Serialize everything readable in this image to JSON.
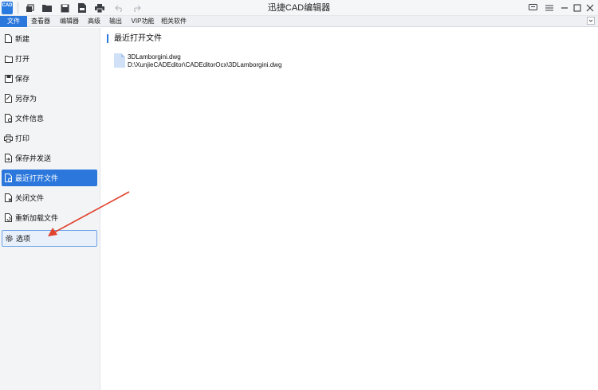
{
  "app": {
    "title": "迅捷CAD编辑器",
    "logo_text": "CAD"
  },
  "quick_access": [
    {
      "name": "new-window-icon"
    },
    {
      "name": "open-folder-icon"
    },
    {
      "name": "save-icon"
    },
    {
      "name": "export-pdf-icon"
    },
    {
      "name": "print-icon"
    },
    {
      "name": "undo-icon"
    },
    {
      "name": "redo-icon"
    }
  ],
  "window_controls": [
    {
      "name": "message-icon"
    },
    {
      "name": "menu-icon"
    },
    {
      "name": "minimize-icon"
    },
    {
      "name": "maximize-icon"
    },
    {
      "name": "close-icon"
    }
  ],
  "menu": {
    "items": [
      {
        "label": "文件",
        "active": true
      },
      {
        "label": "查看器",
        "active": false
      },
      {
        "label": "编辑器",
        "active": false
      },
      {
        "label": "高级",
        "active": false
      },
      {
        "label": "输出",
        "active": false
      },
      {
        "label": "VIP功能",
        "active": false
      },
      {
        "label": "相关软件",
        "active": false
      }
    ]
  },
  "sidebar": {
    "items": [
      {
        "label": "新建",
        "icon": "new-file-icon",
        "state": "normal"
      },
      {
        "label": "打开",
        "icon": "open-icon",
        "state": "normal"
      },
      {
        "label": "保存",
        "icon": "save-icon",
        "state": "normal"
      },
      {
        "label": "另存为",
        "icon": "save-as-icon",
        "state": "normal"
      },
      {
        "label": "文件信息",
        "icon": "file-info-icon",
        "state": "normal"
      },
      {
        "label": "打印",
        "icon": "print-icon",
        "state": "normal"
      },
      {
        "label": "保存并发送",
        "icon": "save-send-icon",
        "state": "normal"
      },
      {
        "label": "最近打开文件",
        "icon": "recent-files-icon",
        "state": "active"
      },
      {
        "label": "关闭文件",
        "icon": "close-file-icon",
        "state": "normal"
      },
      {
        "label": "重新加载文件",
        "icon": "reload-file-icon",
        "state": "normal"
      },
      {
        "label": "选项",
        "icon": "gear-icon",
        "state": "hover"
      }
    ]
  },
  "main": {
    "section_title": "最近打开文件",
    "recent_files": [
      {
        "name": "3DLamborgini.dwg",
        "path": "D:\\XunjieCADEditor\\CADEditorOcx\\3DLamborgini.dwg"
      }
    ]
  },
  "colors": {
    "accent": "#2b77dc",
    "arrow": "#e0432e",
    "sidebar_bg": "#f3f4f6"
  }
}
